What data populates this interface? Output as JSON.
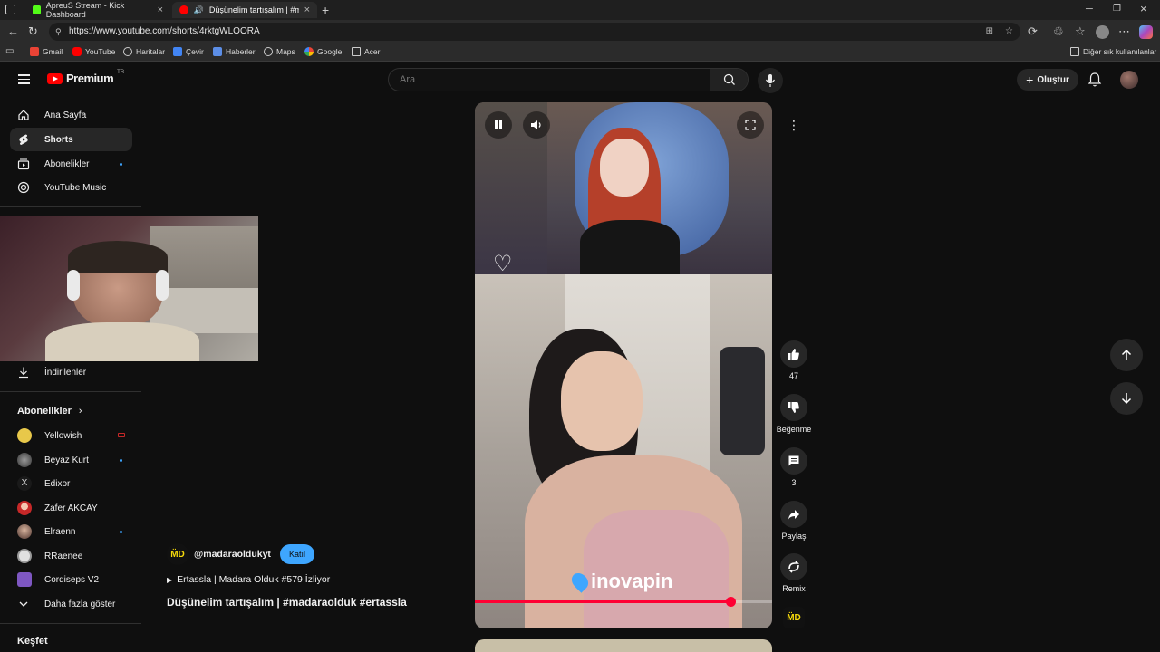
{
  "browser": {
    "tabs": [
      {
        "title": "ApreuS Stream - Kick Dashboard",
        "favicon_color": "#53fc18"
      },
      {
        "title": "Düşünelim tartışalım | #mad",
        "favicon_color": "#ff0000"
      }
    ],
    "url": "https://www.youtube.com/shorts/4rktgWLOORA",
    "bookmarks": [
      "Gmail",
      "YouTube",
      "Haritalar",
      "Çevir",
      "Haberler",
      "Maps",
      "Google",
      "Acer"
    ],
    "other_bookmarks": "Diğer sık kullanılanlar"
  },
  "header": {
    "brand": "Premium",
    "region": "TR",
    "search_placeholder": "Ara",
    "create_label": "Oluştur"
  },
  "sidebar": {
    "main": [
      {
        "label": "Ana Sayfa",
        "icon": "home-icon"
      },
      {
        "label": "Shorts",
        "icon": "shorts-icon"
      },
      {
        "label": "Abonelikler",
        "icon": "subscriptions-icon"
      },
      {
        "label": "YouTube Music",
        "icon": "music-icon"
      }
    ],
    "downloads": "İndirilenler",
    "subscriptions_header": "Abonelikler",
    "subscriptions": [
      {
        "name": "Yellowish",
        "avatar_color": "#e8c84a"
      },
      {
        "name": "Beyaz Kurt",
        "avatar_color": "#555555"
      },
      {
        "name": "Edixor",
        "avatar_color": "#222222"
      },
      {
        "name": "Zafer AKCAY",
        "avatar_color": "#c62828"
      },
      {
        "name": "Elraenn",
        "avatar_color": "#8d6e63"
      },
      {
        "name": "RRaenee",
        "avatar_color": "#dddddd"
      },
      {
        "name": "Cordiseps V2",
        "avatar_color": "#7e57c2"
      }
    ],
    "show_more": "Daha fazla göster",
    "explore": "Keşfet"
  },
  "short": {
    "channel": "@madaraoldukyt",
    "channel_avatar_text": "M̈D",
    "join_label": "Katıl",
    "playlist": "Ertassla | Madara Olduk #579 İzliyor",
    "title": "Düşünelim tartışalım | #madaraolduk #ertassla",
    "watermark": "inovapin",
    "progress_fraction": 0.86,
    "likes": "47",
    "dislike_label": "Beğenme",
    "comments": "3",
    "share_label": "Paylaş",
    "remix_label": "Remix"
  }
}
